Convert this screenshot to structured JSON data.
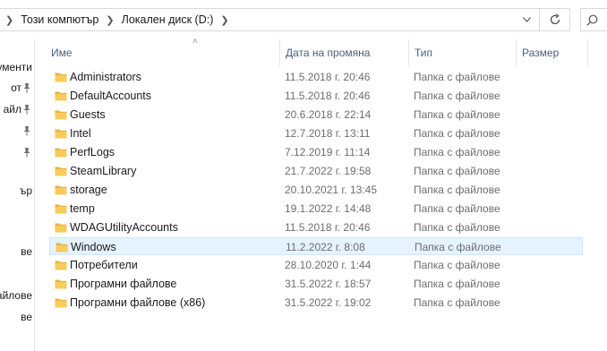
{
  "breadcrumb": {
    "items": [
      "Този компютър",
      "Локален диск (D:)"
    ]
  },
  "nav": {
    "items": [
      {
        "label": "ументи",
        "pinned": false
      },
      {
        "label": "от",
        "pinned": true
      },
      {
        "label": "айл",
        "pinned": true
      },
      {
        "label": "",
        "pinned": true
      },
      {
        "label": "",
        "pinned": true
      },
      {
        "label": "ър",
        "pinned": false
      },
      {
        "label": "ве",
        "pinned": false
      },
      {
        "label": "айлове",
        "pinned": false
      },
      {
        "label": "ве",
        "pinned": false
      }
    ]
  },
  "columns": {
    "name": "Име",
    "date": "Дата на промяна",
    "type": "Тип",
    "size": "Размер"
  },
  "files": [
    {
      "name": "Administrators",
      "date": "11.5.2018 г. 20:46",
      "type": "Папка с файлове"
    },
    {
      "name": "DefaultAccounts",
      "date": "11.5.2018 г. 20:46",
      "type": "Папка с файлове"
    },
    {
      "name": "Guests",
      "date": "20.6.2018 г. 22:14",
      "type": "Папка с файлове"
    },
    {
      "name": "Intel",
      "date": "12.7.2018 г. 13:11",
      "type": "Папка с файлове"
    },
    {
      "name": "PerfLogs",
      "date": "7.12.2019 г. 11:14",
      "type": "Папка с файлове"
    },
    {
      "name": "SteamLibrary",
      "date": "21.7.2022 г. 19:58",
      "type": "Папка с файлове"
    },
    {
      "name": "storage",
      "date": "20.10.2021 г. 13:45",
      "type": "Папка с файлове"
    },
    {
      "name": "temp",
      "date": "19.1.2022 г. 14:48",
      "type": "Папка с файлове"
    },
    {
      "name": "WDAGUtilityAccounts",
      "date": "11.5.2018 г. 20:46",
      "type": "Папка с файлове"
    },
    {
      "name": "Windows",
      "date": "11.2.2022 г. 8:08",
      "type": "Папка с файлове"
    },
    {
      "name": "Потребители",
      "date": "28.10.2020 г. 1:44",
      "type": "Папка с файлове"
    },
    {
      "name": "Програмни файлове",
      "date": "31.5.2022 г. 18:57",
      "type": "Папка с файлове"
    },
    {
      "name": "Програмни файлове (x86)",
      "date": "31.5.2022 г. 19:02",
      "type": "Папка с файлове"
    }
  ],
  "hovered_row": "Windows",
  "colors": {
    "folder": "#f6cc5a",
    "folder_dark": "#e7b13c",
    "hover_bg": "#e5f3ff",
    "header_text": "#4c607a"
  }
}
